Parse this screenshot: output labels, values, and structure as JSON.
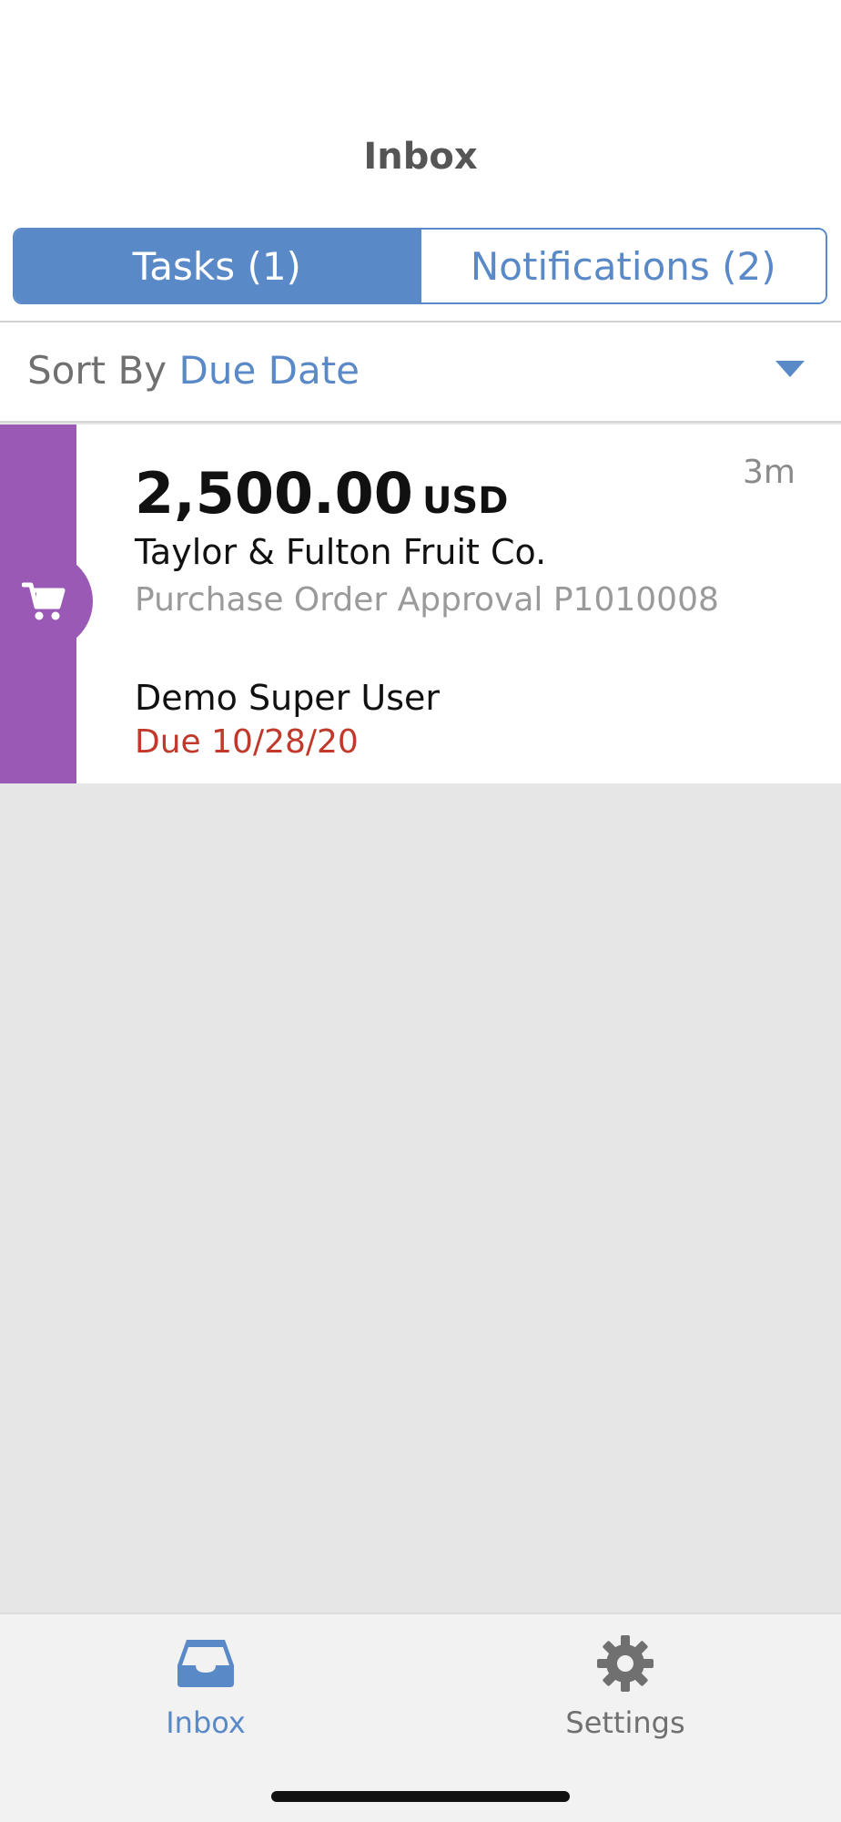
{
  "header": {
    "title": "Inbox"
  },
  "segments": {
    "tasks_label": "Tasks (1)",
    "notifications_label": "Notifications (2)"
  },
  "sort": {
    "prefix": "Sort By",
    "value": "Due Date"
  },
  "task": {
    "amount": "2,500.00",
    "currency": "USD",
    "age": "3m",
    "vendor": "Taylor & Fulton Fruit Co.",
    "document": "Purchase Order Approval P1010008",
    "assigned_user": "Demo Super User",
    "due": "Due 10/28/20",
    "category_icon": "shopping-cart-icon",
    "category_color": "#9b59b6"
  },
  "tabbar": {
    "inbox_label": "Inbox",
    "settings_label": "Settings"
  },
  "colors": {
    "accent": "#5a89c8",
    "due_red": "#c0392b"
  }
}
